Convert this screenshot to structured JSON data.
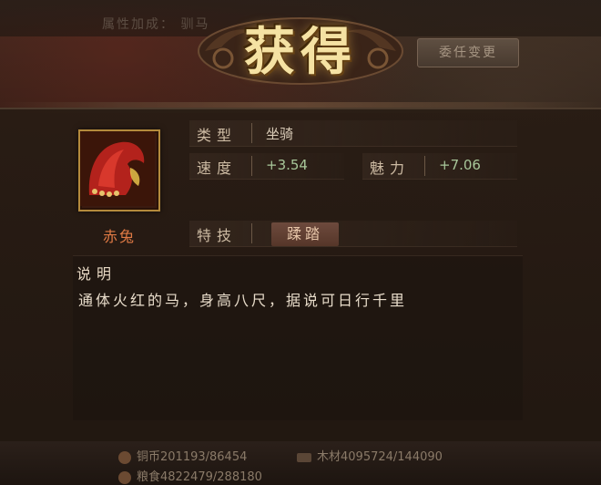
{
  "header": {
    "attr_bonus_faded": "属性加成：  驯马",
    "faded_button_label": "委任变更"
  },
  "title": "获得",
  "item": {
    "name": "赤兔",
    "icon": "red-horse-icon"
  },
  "stats": {
    "type_label": "类型",
    "type_value": "坐骑",
    "speed_label": "速度",
    "speed_value": "+3.54",
    "charm_label": "魅力",
    "charm_value": "+7.06",
    "skill_label": "特技",
    "skill_value": "蹂踏"
  },
  "description": {
    "title": "说明",
    "text": "通体火红的马，身高八尺，据说可日行千里"
  },
  "resources": {
    "copper": "铜币201193/86454",
    "wood": "木材4095724/144090",
    "grain": "粮食4822479/288180"
  },
  "colors": {
    "title_gold": "#f5e2a3",
    "item_name": "#e07a45",
    "positive_value": "#a8c79a",
    "frame_gold": "#b48a3c"
  }
}
